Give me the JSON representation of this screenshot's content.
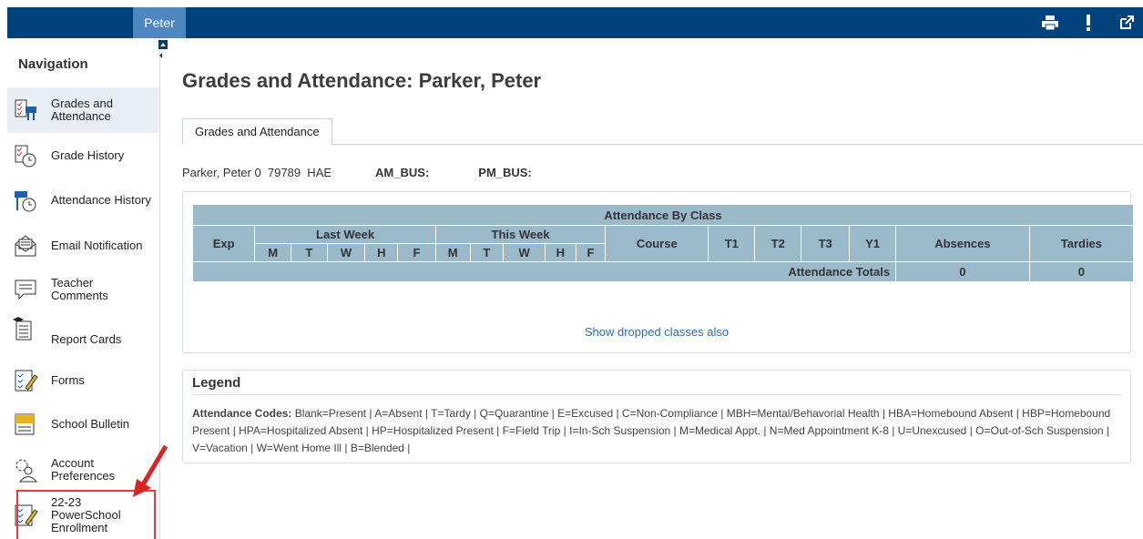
{
  "topbar": {
    "user_name": "Peter",
    "icons": [
      "printer-icon",
      "alert-icon",
      "external-link-icon"
    ]
  },
  "sidebar": {
    "heading": "Navigation",
    "items": [
      {
        "label": "Grades and Attendance",
        "icon": "grades-attendance-icon"
      },
      {
        "label": "Grade History",
        "icon": "grade-history-icon"
      },
      {
        "label": "Attendance History",
        "icon": "attendance-history-icon"
      },
      {
        "label": "Email Notification",
        "icon": "email-icon"
      },
      {
        "label": "Teacher Comments",
        "icon": "comments-icon"
      },
      {
        "label": "Report Cards",
        "icon": "report-card-icon"
      },
      {
        "label": "Forms",
        "icon": "forms-icon"
      },
      {
        "label": "School Bulletin",
        "icon": "bulletin-icon"
      },
      {
        "label": "Account Preferences",
        "icon": "account-preferences-icon"
      },
      {
        "label": "22-23 PowerSchool Enrollment",
        "icon": "enrollment-icon"
      }
    ]
  },
  "main": {
    "title": "Grades and Attendance: Parker, Peter",
    "tab": "Grades and Attendance",
    "student": {
      "name_line": "Parker, Peter 0  79789  HAE",
      "am_bus_label": "AM_BUS:",
      "pm_bus_label": "PM_BUS:"
    },
    "attendance": {
      "title": "Attendance By Class",
      "exp": "Exp",
      "last_week": "Last Week",
      "this_week": "This Week",
      "days": [
        "M",
        "T",
        "W",
        "H",
        "F"
      ],
      "course": "Course",
      "t1": "T1",
      "t2": "T2",
      "t3": "T3",
      "y1": "Y1",
      "absences": "Absences",
      "tardies": "Tardies",
      "totals_label": "Attendance Totals",
      "total_absences": "0",
      "total_tardies": "0",
      "show_dropped": "Show dropped classes also"
    },
    "legend": {
      "title": "Legend",
      "codes_label": "Attendance Codes:",
      "codes_text": " Blank=Present | A=Absent | T=Tardy | Q=Quarantine | E=Excused | C=Non-Compliance | MBH=Mental/Behavorial Health | HBA=Homebound Absent | HBP=Homebound Present | HPA=Hospitalized Absent | HP=Hospitalized Present | F=Field Trip | I=In-Sch Suspension | M=Medical Appt. | N=Med Appointment K-8 | U=Unexcused | O=Out-of-Sch Suspension | V=Vacation | W=Went Home Ill | B=Blended |"
    }
  },
  "colors": {
    "topbar": "#00427c",
    "user_tab": "#4e86c0",
    "table_header": "#9ab9c9",
    "link": "#2a6cb5",
    "highlight": "#e03c3c"
  }
}
